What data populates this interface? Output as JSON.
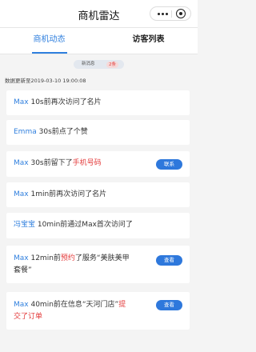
{
  "nav": {
    "title": "商机雷达"
  },
  "tabs": [
    {
      "label": "商机动态"
    },
    {
      "label": "访客列表"
    }
  ],
  "notice": {
    "label": "新消息",
    "count": "2条"
  },
  "update_text": "数据更新至2019-03-10 19:00:08",
  "cards": [
    {
      "user": "Max",
      "text": " 10s前再次访问了名片"
    },
    {
      "user": "Emma",
      "text": " 30s前点了个赞"
    },
    {
      "user": "Max",
      "text": " 30s前留下了",
      "highlight": "手机号码",
      "button": "联系"
    },
    {
      "user": "Max",
      "text": " 1min前再次访问了名片"
    },
    {
      "user": "冯宝宝",
      "text": " 10min前通过Max首次访问了"
    },
    {
      "user": "Max",
      "text": " 12min前",
      "highlight": "预约",
      "text2": "了服务“美肤美甲",
      "text3": "套餐”",
      "button": "查看"
    },
    {
      "user": "Max",
      "text": " 40min前在信息“天河门店”",
      "highlight": "提",
      "highlight2": "交了订单",
      "button": "查看"
    }
  ],
  "colors": {
    "accent": "#2f7fde",
    "highlight": "#e33b3b",
    "button": "#2e78dc"
  }
}
